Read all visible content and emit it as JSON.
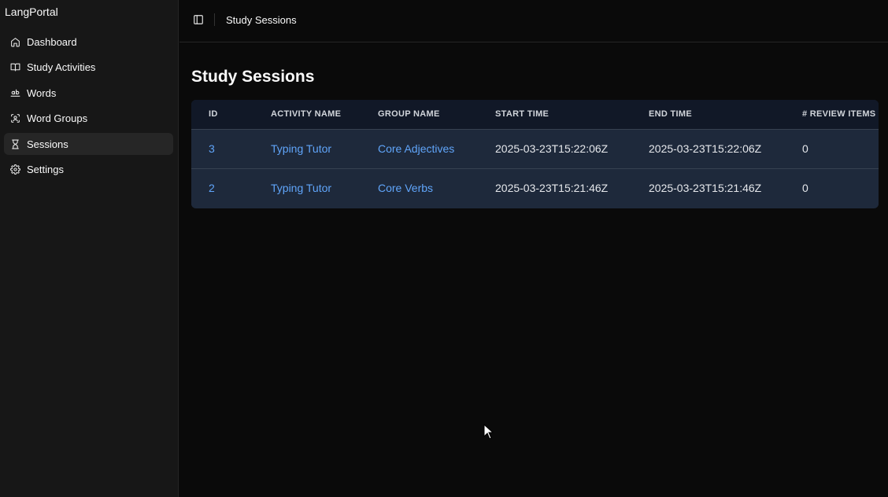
{
  "app": {
    "brand": "LangPortal"
  },
  "sidebar": {
    "items": [
      {
        "label": "Dashboard",
        "icon": "home-icon",
        "active": false
      },
      {
        "label": "Study Activities",
        "icon": "book-open-icon",
        "active": false
      },
      {
        "label": "Words",
        "icon": "whole-word-icon",
        "active": false
      },
      {
        "label": "Word Groups",
        "icon": "group-icon",
        "active": false
      },
      {
        "label": "Sessions",
        "icon": "hourglass-icon",
        "active": true
      },
      {
        "label": "Settings",
        "icon": "gear-icon",
        "active": false
      }
    ]
  },
  "header": {
    "breadcrumb": "Study Sessions"
  },
  "main": {
    "title": "Study Sessions",
    "table": {
      "columns": [
        "ID",
        "ACTIVITY NAME",
        "GROUP NAME",
        "START TIME",
        "END TIME",
        "# REVIEW ITEMS"
      ],
      "rows": [
        {
          "id": "3",
          "activity": "Typing Tutor",
          "group": "Core Adjectives",
          "start": "2025-03-23T15:22:06Z",
          "end": "2025-03-23T15:22:06Z",
          "review_items": "0"
        },
        {
          "id": "2",
          "activity": "Typing Tutor",
          "group": "Core Verbs",
          "start": "2025-03-23T15:21:46Z",
          "end": "2025-03-23T15:21:46Z",
          "review_items": "0"
        }
      ]
    }
  },
  "colors": {
    "background": "#0a0a0a",
    "sidebar": "#171717",
    "link": "#60a5fa",
    "table_header": "#111827",
    "table_body": "#1e293b"
  }
}
